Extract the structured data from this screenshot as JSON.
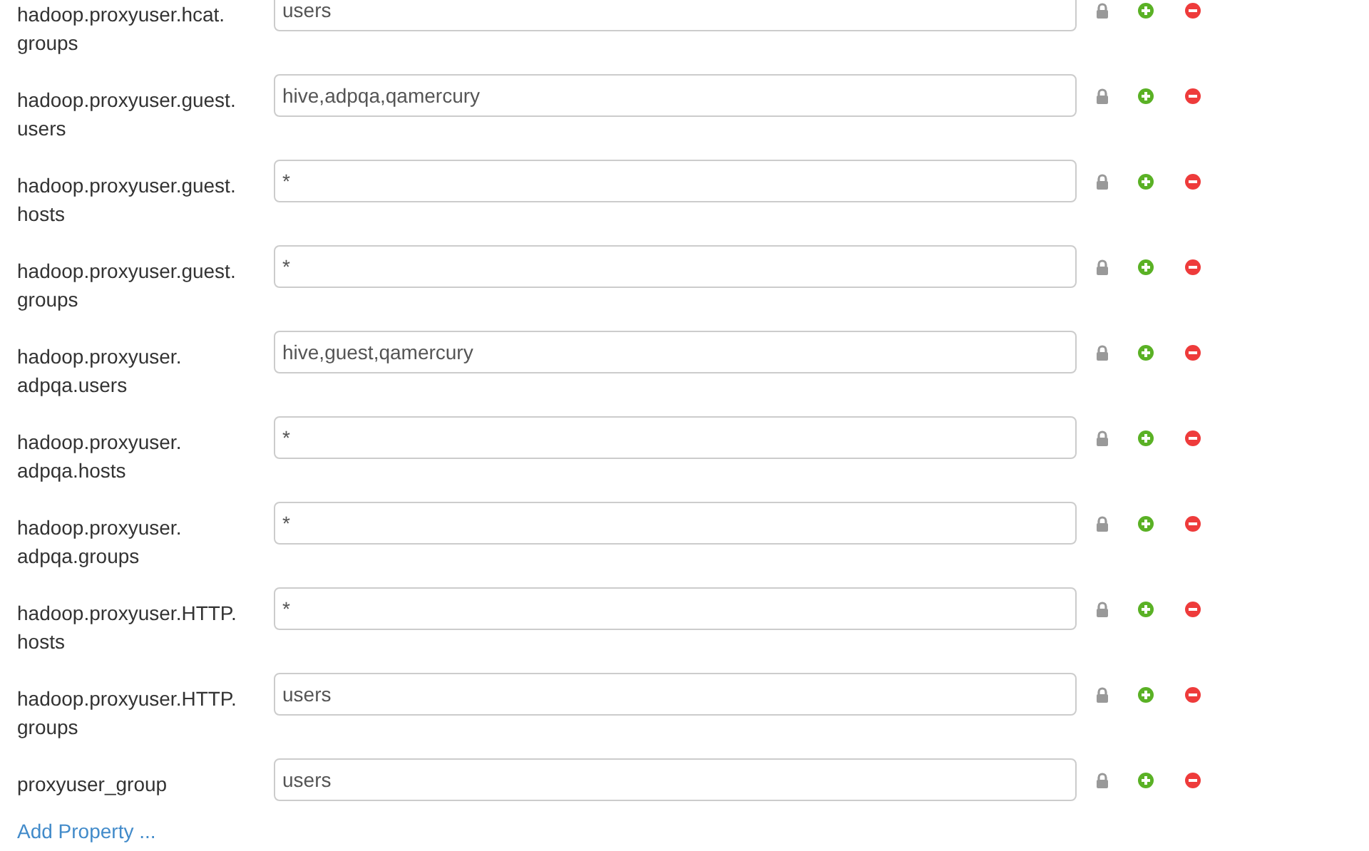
{
  "properties": [
    {
      "name": "hadoop.proxyuser.hcat.groups",
      "value": "users"
    },
    {
      "name": "hadoop.proxyuser.guest.users",
      "value": "hive,adpqa,qamercury"
    },
    {
      "name": "hadoop.proxyuser.guest.hosts",
      "value": "*"
    },
    {
      "name": "hadoop.proxyuser.guest.groups",
      "value": "*"
    },
    {
      "name": "hadoop.proxyuser.adpqa.users",
      "value": "hive,guest,qamercury"
    },
    {
      "name": "hadoop.proxyuser.adpqa.hosts",
      "value": "*"
    },
    {
      "name": "hadoop.proxyuser.adpqa.groups",
      "value": "*"
    },
    {
      "name": "hadoop.proxyuser.HTTP.hosts",
      "value": "*"
    },
    {
      "name": "hadoop.proxyuser.HTTP.groups",
      "value": "users"
    },
    {
      "name": "proxyuser_group",
      "value": "users"
    }
  ],
  "add_link": "Add Property ..."
}
